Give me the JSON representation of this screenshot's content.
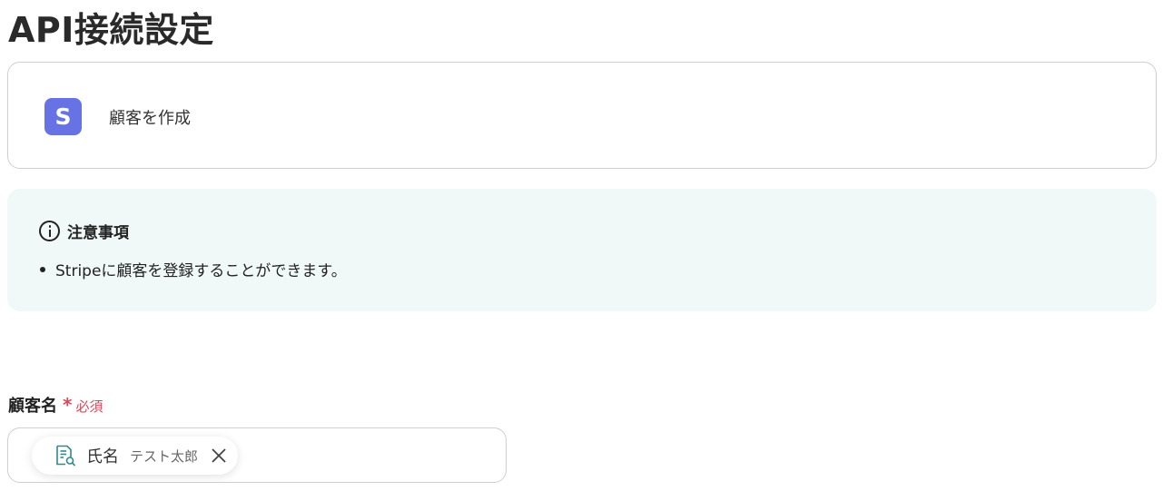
{
  "page": {
    "title": "API接続設定"
  },
  "action": {
    "app_icon_letter": "S",
    "label": "顧客を作成",
    "icon_color": "#6772e5"
  },
  "notice": {
    "title": "注意事項",
    "items": [
      "Stripeに顧客を登録することができます。"
    ],
    "background": "#f0f9f8"
  },
  "field": {
    "label": "顧客名",
    "required_mark": "*",
    "required_text": "必須",
    "required_color": "#e0455c",
    "chip": {
      "icon": "document-search-icon",
      "label": "氏名",
      "value": "テスト太郎",
      "remove_icon": "close-icon"
    }
  }
}
